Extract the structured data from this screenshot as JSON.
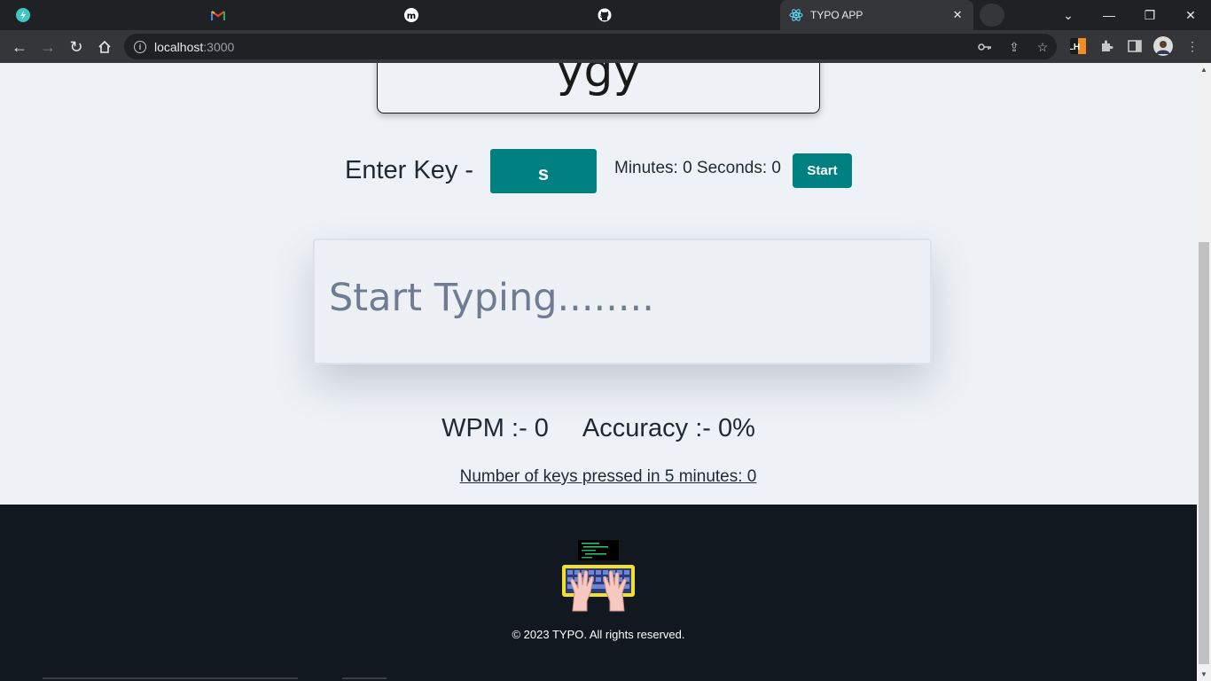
{
  "browser": {
    "tabs": [
      {
        "icon": "bolt-icon",
        "title": ""
      },
      {
        "icon": "gmail-icon",
        "title": ""
      },
      {
        "icon": "medium-icon",
        "title": ""
      },
      {
        "icon": "github-icon",
        "title": ""
      },
      {
        "icon": "react-icon",
        "title": "TYPO APP",
        "active": true
      }
    ],
    "url_host": "localhost",
    "url_port": ":3000",
    "profile_ext_label": "LH"
  },
  "word_card": {
    "text": "ygy"
  },
  "controls": {
    "enter_key_label": "Enter Key -",
    "current_key": "s",
    "timer_text": "Minutes: 0 Seconds: 0",
    "start_label": "Start"
  },
  "typing": {
    "placeholder": "Start Typing........"
  },
  "stats": {
    "wpm_text": "WPM :- 0",
    "accuracy_text": "Accuracy :- 0%",
    "keys_pressed_text": "Number of keys pressed in 5 minutes: 0"
  },
  "footer": {
    "copyright": "© 2023 TYPO. All rights reserved."
  },
  "colors": {
    "accent": "#008080",
    "footer_bg": "#111820",
    "page_bg": "#eef2f6"
  }
}
